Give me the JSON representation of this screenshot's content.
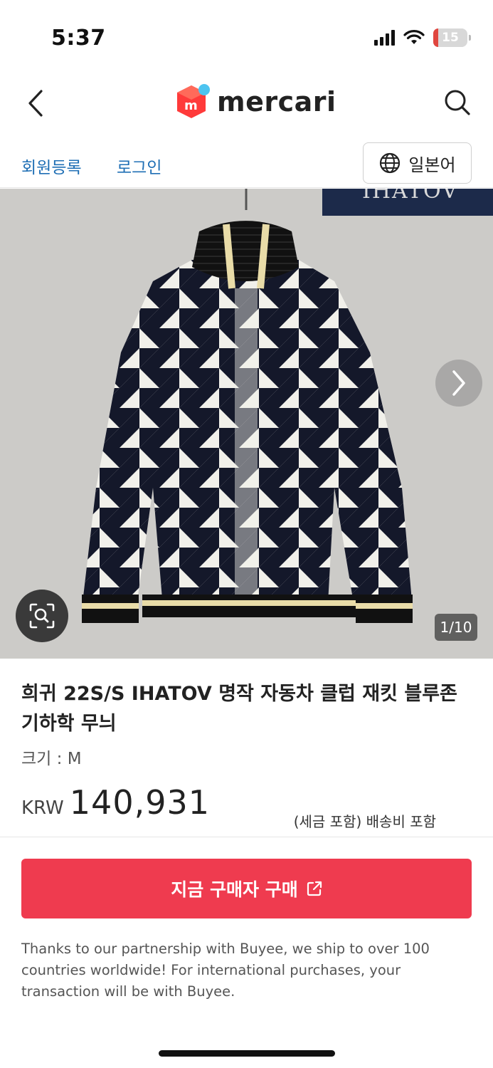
{
  "status_bar": {
    "time": "5:37",
    "battery_level": "15",
    "icons": [
      "signal-icon",
      "wifi-icon",
      "battery-icon"
    ]
  },
  "header": {
    "logo_text": "mercari",
    "icons": [
      "back-arrow-icon",
      "mercari-logo-icon",
      "search-icon"
    ]
  },
  "member_bar": {
    "signup": "회원등록",
    "login": "로그인",
    "language": "일본어",
    "language_icon": "globe-icon"
  },
  "gallery": {
    "banner_text": "IHATOV",
    "counter": "1/10",
    "icons": [
      "chevron-right-icon",
      "image-search-icon"
    ]
  },
  "product": {
    "title": "희귀 22S/S IHATOV 명작 자동차 클럽 재킷 블루존 기하학 무늬",
    "size": "크기 : M",
    "currency": "KRW",
    "price": "140,931",
    "price_note": "(세금 포함) 배송비 포함"
  },
  "buy": {
    "label": "지금 구매자 구매",
    "icon": "external-link-icon",
    "color": "#ef3b4f"
  },
  "partner_note": "Thanks to our partnership with Buyee, we ship to over 100 countries worldwide! For international purchases, your transaction will be with Buyee.",
  "colors": {
    "link": "#1f6fb5",
    "brand_red": "#ef3b4f"
  }
}
